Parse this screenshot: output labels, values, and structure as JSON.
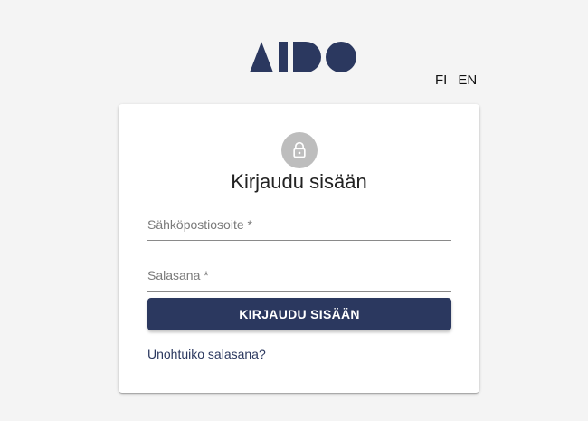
{
  "brand": {
    "logo_text": "AIDO",
    "color": "#2b385f"
  },
  "language": {
    "options": [
      "FI",
      "EN"
    ]
  },
  "login": {
    "icon": "lock-icon",
    "title": "Kirjaudu sisään",
    "email_label": "Sähköpostiosoite *",
    "email_value": "",
    "password_label": "Salasana *",
    "password_value": "",
    "submit_label": "KIRJAUDU SISÄÄN",
    "forgot_link": "Unohtuiko salasana?"
  },
  "colors": {
    "primary": "#2b385f",
    "icon_bg": "#bdbdbd",
    "background": "#f4f4f4"
  }
}
